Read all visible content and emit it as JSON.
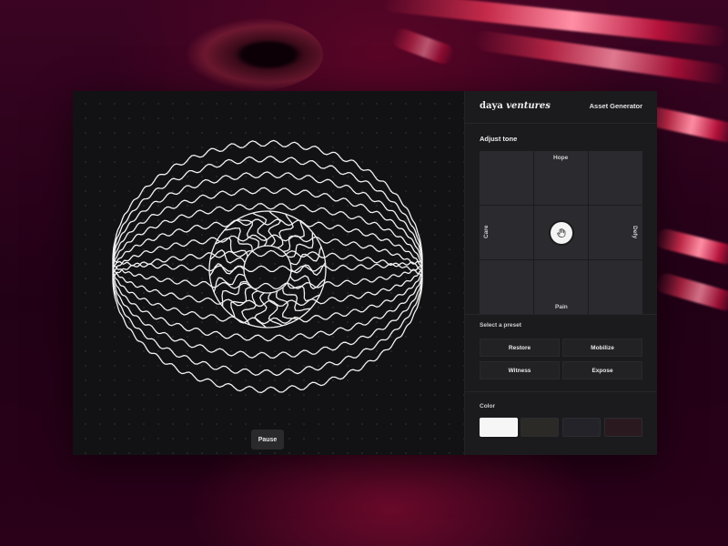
{
  "brand": {
    "name": "daya",
    "name_italic": "ventures"
  },
  "header": {
    "title": "Asset Generator"
  },
  "tone": {
    "heading": "Adjust tone",
    "axes": {
      "top": "Hope",
      "bottom": "Pain",
      "left": "Care",
      "right": "Defy"
    },
    "knob_icon": "hand-icon"
  },
  "presets": {
    "heading": "Select a preset",
    "items": [
      "Restore",
      "Mobilize",
      "Witness",
      "Expose"
    ]
  },
  "color": {
    "heading": "Color",
    "swatches": [
      "#f7f6f6",
      "#2b2a27",
      "#24232a",
      "#2a1a20"
    ],
    "selected": 0
  },
  "canvas": {
    "pause_label": "Pause"
  }
}
